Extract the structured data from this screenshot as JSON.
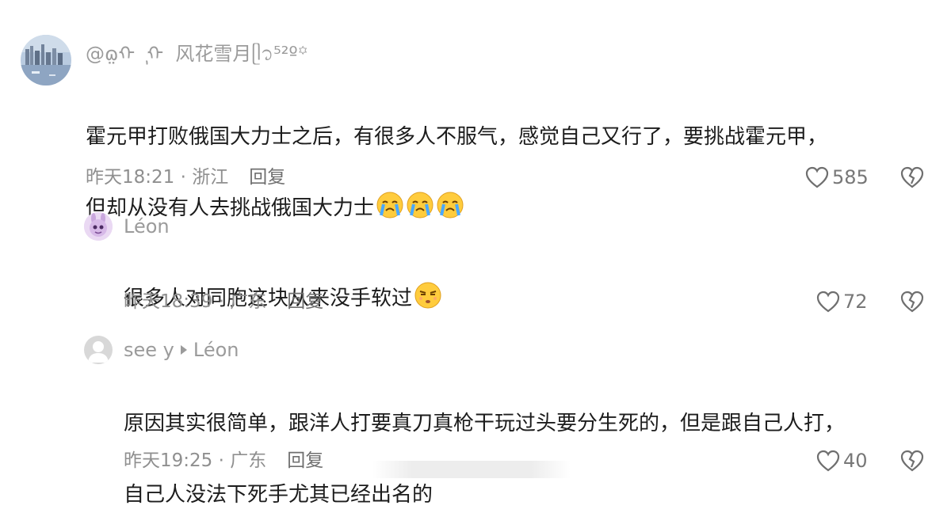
{
  "comments": [
    {
      "username": "@ɷ̤ᡣ ٖ ᡣ ͏ 风花雪月ᥫ᭡⁵²º꙳",
      "text_line1": "霍元甲打败俄国大力士之后，有很多人不服气，感觉自己又行了，要挑战霍元甲，",
      "text_line2": "但却从没有人去挑战俄国大力士",
      "time": "昨天18:21",
      "location": "浙江",
      "reply_label": "回复",
      "likes": "585"
    },
    {
      "username": "Léon",
      "text_line1": "很多人对同胞这块从来没手软过",
      "time": "昨天18:39",
      "location": "广东",
      "reply_label": "回复",
      "likes": "72"
    },
    {
      "username": "see y",
      "reply_to": "Léon",
      "text_line1": "原因其实很简单，跟洋人打要真刀真枪干玩过头要分生死的，但是跟自己人打，",
      "text_line2": "自己人没法下死手尤其已经出名的",
      "time": "昨天19:25",
      "location": "广东",
      "reply_label": "回复",
      "likes": "40"
    }
  ],
  "separator": " · ",
  "icons": {
    "like": "heart-outline-icon",
    "dislike": "broken-heart-icon",
    "emoji_cry": "crying-face-emoji",
    "emoji_sigh": "unamused-face-emoji"
  },
  "colors": {
    "text": "#1c1c1c",
    "meta": "#8f8f8f",
    "username": "#9b9b9b"
  }
}
